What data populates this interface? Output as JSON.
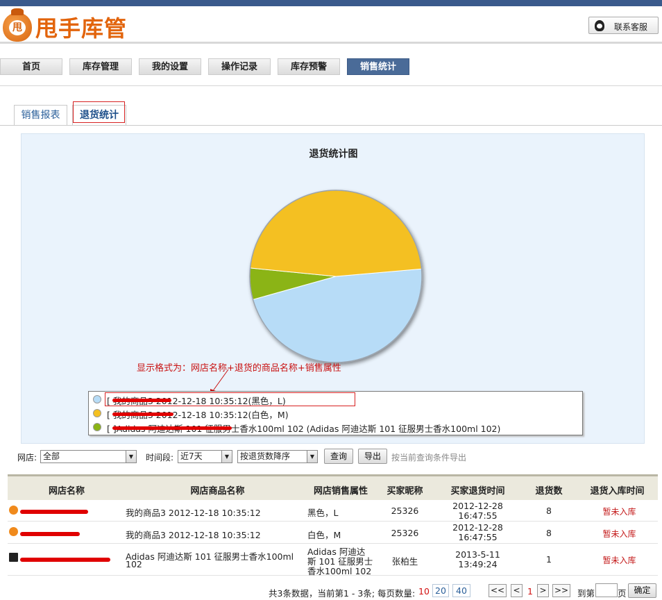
{
  "app": {
    "logo_text": "甩手库管",
    "logo_mark": "甩",
    "contact_label": "联系客服"
  },
  "nav": [
    "首页",
    "库存管理",
    "我的设置",
    "操作记录",
    "库存预警",
    "销售统计"
  ],
  "tabs": [
    "销售报表",
    "退货统计"
  ],
  "chart": {
    "annotation": "显示格式为：网店名称+退货的商品名称+销售属性",
    "legend": [
      {
        "text": "[                    我的商品3 2012-12-18 10:35:12(黑色，L)",
        "color": "#b7dcf7"
      },
      {
        "text": "[                    我的商品3 2012-12-18 10:35:12(白色，M)",
        "color": "#f4c020"
      },
      {
        "text": "[                                    ]Adidas 阿迪达斯 101 征服男士香水100ml 102 (Adidas 阿迪达斯 101 征服男士香水100ml 102)",
        "color": "#8bb414"
      }
    ]
  },
  "chart_data": {
    "type": "pie",
    "title": "退货统计图",
    "slices": [
      {
        "label": "我的商品3 2012-12-18 10:35:12(黑色，L)",
        "value": 8,
        "color": "#b7dcf7"
      },
      {
        "label": "我的商品3 2012-12-18 10:35:12(白色，M)",
        "value": 8,
        "color": "#f4c020"
      },
      {
        "label": "Adidas 阿迪达斯 101 征服男士香水100ml 102",
        "value": 1,
        "color": "#8bb414"
      }
    ],
    "legend": "bottom"
  },
  "filters": {
    "shop_label": "网店:",
    "shop_value": "全部",
    "period_label": "时间段:",
    "period_value": "近7天",
    "sort_value": "按退货数降序",
    "query_btn": "查询",
    "export_btn": "导出",
    "export_hint": "按当前查询条件导出"
  },
  "table": {
    "headers": [
      "网店名称",
      "网店商品名称",
      "网店销售属性",
      "买家昵称",
      "买家退货时间",
      "退货数",
      "退货入库时间"
    ],
    "rows": [
      {
        "product": "我的商品3 2012-12-18 10:35:12",
        "attr": "黑色，L",
        "buyer": "25326",
        "time1": "2012-12-28",
        "time2": "16:47:55",
        "count": "8",
        "status": "暂未入库"
      },
      {
        "product": "我的商品3 2012-12-18 10:35:12",
        "attr": "白色，M",
        "buyer": "25326",
        "time1": "2012-12-28",
        "time2": "16:47:55",
        "count": "8",
        "status": "暂未入库"
      },
      {
        "product1": "Adidas 阿迪达斯 101 征服男士香水100ml",
        "product2": "102",
        "attr1": "Adidas 阿迪达",
        "attr2": "斯 101 征服男士",
        "attr3": "香水100ml 102",
        "buyer": "张柏生",
        "time1": "2013-5-11",
        "time2": "13:49:24",
        "count": "1",
        "status": "暂未入库"
      }
    ]
  },
  "pager": {
    "summary": "共3条数据，当前第1 - 3条; 每页数量:",
    "size_current": "10",
    "sizes": [
      "20",
      "40"
    ],
    "first": "<<",
    "prev": "<",
    "page": "1",
    "next": ">",
    "last": ">>",
    "goto_label": "到第",
    "page_unit": "页",
    "confirm": "确定"
  }
}
